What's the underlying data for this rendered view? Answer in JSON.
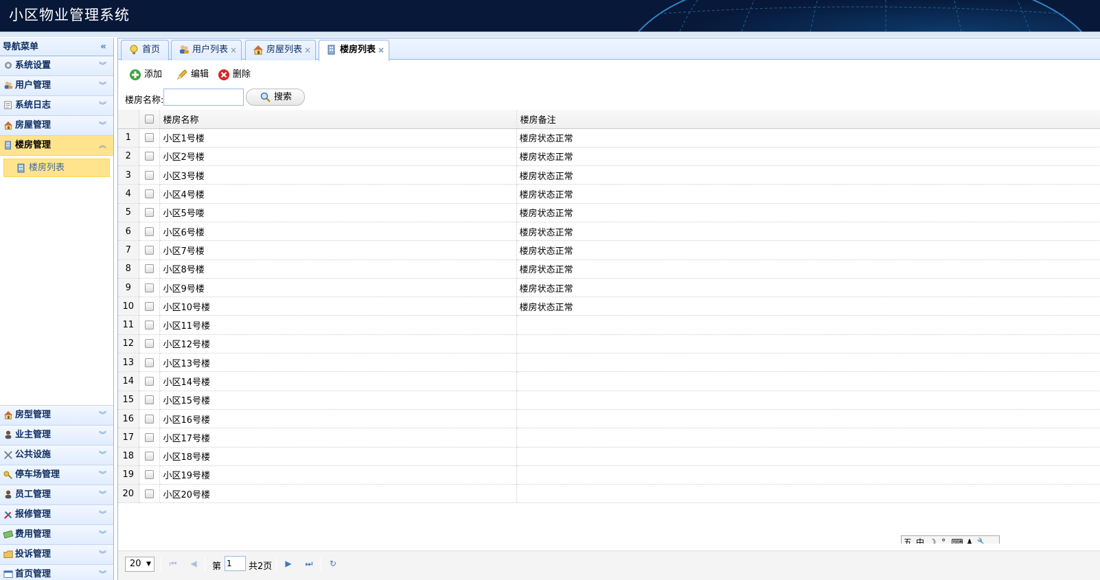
{
  "header": {
    "title": "小区物业管理系统"
  },
  "sidebar": {
    "heading": "导航菜单",
    "top_items": [
      {
        "label": "系统设置",
        "icon": "gear-icon"
      },
      {
        "label": "用户管理",
        "icon": "users-icon"
      },
      {
        "label": "系统日志",
        "icon": "log-icon"
      },
      {
        "label": "房屋管理",
        "icon": "house-icon"
      },
      {
        "label": "楼房管理",
        "icon": "building-icon",
        "active": true
      }
    ],
    "sub_items": [
      {
        "label": "楼房列表",
        "icon": "building-icon"
      }
    ],
    "bottom_items": [
      {
        "label": "房型管理",
        "icon": "house-icon"
      },
      {
        "label": "业主管理",
        "icon": "person-icon"
      },
      {
        "label": "公共设施",
        "icon": "tools-icon"
      },
      {
        "label": "停车场管理",
        "icon": "key-icon"
      },
      {
        "label": "员工管理",
        "icon": "person-icon"
      },
      {
        "label": "报修管理",
        "icon": "wrench-icon"
      },
      {
        "label": "费用管理",
        "icon": "money-icon"
      },
      {
        "label": "投诉管理",
        "icon": "folder-icon"
      },
      {
        "label": "首页管理",
        "icon": "window-icon"
      }
    ]
  },
  "tabs": [
    {
      "label": "首页",
      "icon": "bulb-icon",
      "closable": false
    },
    {
      "label": "用户列表",
      "icon": "users-icon",
      "closable": true
    },
    {
      "label": "房屋列表",
      "icon": "house-icon",
      "closable": true
    },
    {
      "label": "楼房列表",
      "icon": "building-icon",
      "closable": true,
      "selected": true
    }
  ],
  "toolbar": {
    "add_label": "添加",
    "edit_label": "编辑",
    "delete_label": "删除"
  },
  "search": {
    "label": "楼房名称:",
    "value": "",
    "button_label": "搜索"
  },
  "grid": {
    "columns": [
      "楼房名称",
      "楼房备注"
    ],
    "rows": [
      {
        "n": "1",
        "name": "小区1号楼",
        "note": "楼房状态正常"
      },
      {
        "n": "2",
        "name": "小区2号楼",
        "note": "楼房状态正常"
      },
      {
        "n": "3",
        "name": "小区3号楼",
        "note": "楼房状态正常"
      },
      {
        "n": "4",
        "name": "小区4号楼",
        "note": "楼房状态正常"
      },
      {
        "n": "5",
        "name": "小区5号喽",
        "note": "楼房状态正常"
      },
      {
        "n": "6",
        "name": "小区6号楼",
        "note": "楼房状态正常"
      },
      {
        "n": "7",
        "name": "小区7号楼",
        "note": "楼房状态正常"
      },
      {
        "n": "8",
        "name": "小区8号楼",
        "note": "楼房状态正常"
      },
      {
        "n": "9",
        "name": "小区9号楼",
        "note": "楼房状态正常"
      },
      {
        "n": "10",
        "name": "小区10号楼",
        "note": "楼房状态正常"
      },
      {
        "n": "11",
        "name": "小区11号楼",
        "note": ""
      },
      {
        "n": "12",
        "name": "小区12号楼",
        "note": ""
      },
      {
        "n": "13",
        "name": "小区13号楼",
        "note": ""
      },
      {
        "n": "14",
        "name": "小区14号楼",
        "note": ""
      },
      {
        "n": "15",
        "name": "小区15号楼",
        "note": ""
      },
      {
        "n": "16",
        "name": "小区16号楼",
        "note": ""
      },
      {
        "n": "17",
        "name": "小区17号楼",
        "note": ""
      },
      {
        "n": "18",
        "name": "小区18号楼",
        "note": ""
      },
      {
        "n": "19",
        "name": "小区19号楼",
        "note": ""
      },
      {
        "n": "20",
        "name": "小区20号楼",
        "note": ""
      }
    ]
  },
  "ime": {
    "items": [
      "五",
      "中",
      "☽",
      "°,",
      "⌨",
      "♟",
      "🔧"
    ]
  },
  "pager": {
    "page_size": "20",
    "page_prefix": "第",
    "page_value": "1",
    "page_total": "共2页"
  },
  "colors": {
    "header_bg": "#071838",
    "panel_border": "#95b8e7",
    "active_bg": "#ffe48d"
  }
}
